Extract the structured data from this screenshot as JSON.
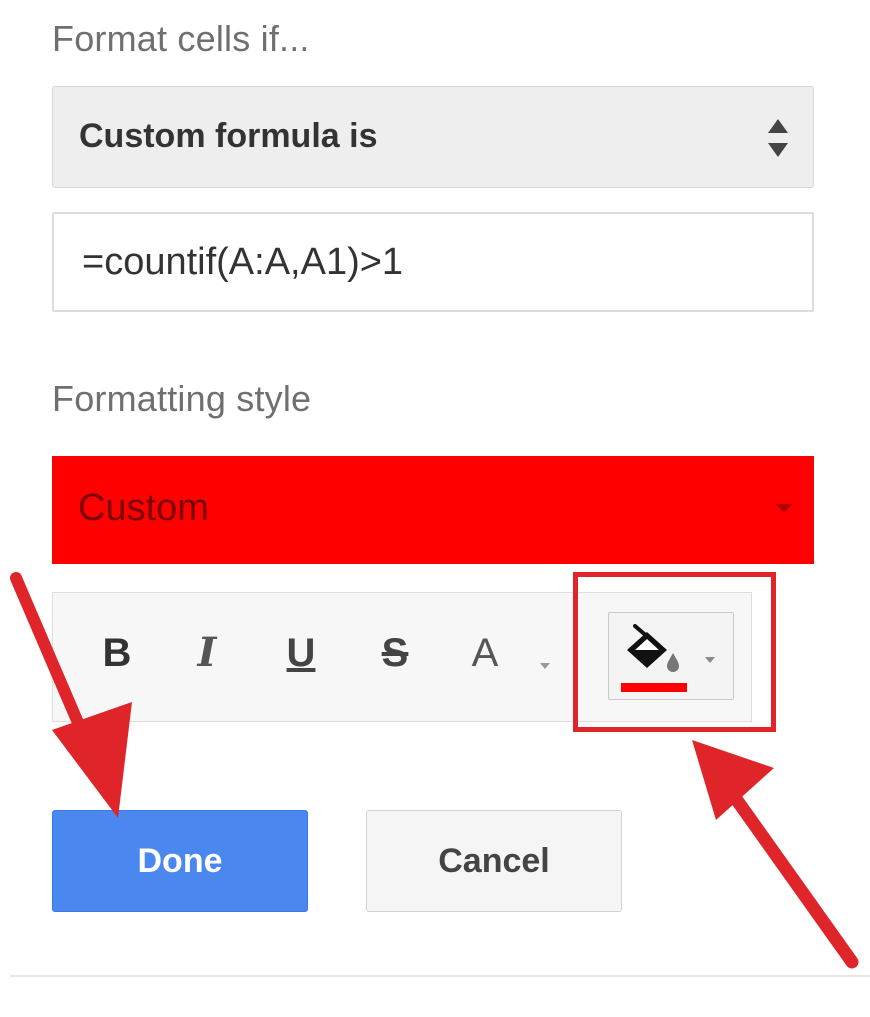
{
  "format_cells": {
    "label": "Format cells if...",
    "condition": {
      "selected": "Custom formula is",
      "icon": "up-down-arrows-icon"
    },
    "formula_value": "=countif(A:A,A1)>1"
  },
  "formatting_style": {
    "label": "Formatting style",
    "selected": "Custom",
    "background_color": "#ff0000",
    "toolbar": {
      "bold_label": "B",
      "italic_label": "I",
      "underline_label": "U",
      "strikethrough_label": "S",
      "text_color_label": "A",
      "fill_icon": "paint-bucket-icon",
      "fill_color": "#ff0000"
    }
  },
  "actions": {
    "done_label": "Done",
    "cancel_label": "Cancel"
  },
  "annotations": {
    "color": "#e0252a",
    "highlighted": "fill-color-button"
  }
}
